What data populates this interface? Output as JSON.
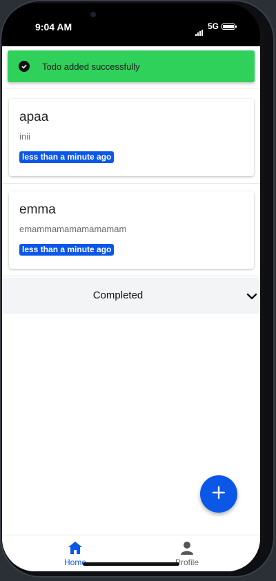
{
  "status_bar": {
    "time": "9:04 AM",
    "network": "5G"
  },
  "toast": {
    "message": "Todo added successfully",
    "color": "#2fd15a"
  },
  "todos": [
    {
      "title": "apaa",
      "description": "inii",
      "time_badge": "less than a minute ago"
    },
    {
      "title": "emma",
      "description": "emammamamamamamam",
      "time_badge": "less than a minute ago"
    }
  ],
  "completed_section": {
    "label": "Completed"
  },
  "fab": {
    "icon": "plus-icon",
    "color": "#0a57e8"
  },
  "bottom_nav": {
    "items": [
      {
        "label": "Home",
        "icon": "home-icon",
        "active": true
      },
      {
        "label": "Profile",
        "icon": "person-icon",
        "active": false
      }
    ]
  },
  "colors": {
    "accent": "#0a57e8"
  }
}
